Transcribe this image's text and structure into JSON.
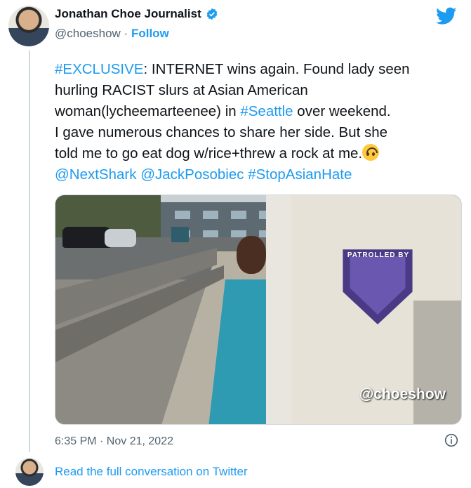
{
  "author": {
    "name": "Jonathan Choe Journalist",
    "handle": "@choeshow",
    "separator": "·",
    "follow_label": "Follow",
    "verified": true
  },
  "tweet": {
    "lines": [
      [
        {
          "t": "#EXCLUSIVE",
          "link": true
        },
        {
          "t": ": INTERNET wins again. Found lady seen",
          "link": false
        }
      ],
      [
        {
          "t": "hurling RACIST slurs at Asian American",
          "link": false
        }
      ],
      [
        {
          "t": "woman(lycheemarteenee) in ",
          "link": false
        },
        {
          "t": "#Seattle",
          "link": true
        },
        {
          "t": " over weekend.",
          "link": false
        }
      ],
      [
        {
          "t": "I gave numerous chances to share her side. But she",
          "link": false
        }
      ],
      [
        {
          "t": "told me to go eat dog w/rice+threw a rock at me.",
          "link": false
        }
      ],
      [
        {
          "t": "@NextShark",
          "link": true
        },
        {
          "t": " ",
          "link": false
        },
        {
          "t": "@JackPosobiec",
          "link": true
        },
        {
          "t": " ",
          "link": false
        },
        {
          "t": "#StopAsianHate",
          "link": true
        }
      ]
    ],
    "emoji_icon": "upside-down-face-emoji"
  },
  "media": {
    "watermark": "@choeshow",
    "badge_text": "PATROLLED BY"
  },
  "meta": {
    "timestamp": "6:35 PM · Nov 21, 2022",
    "read_more": "Read the full conversation on Twitter"
  },
  "colors": {
    "link": "#1d9bf0",
    "muted": "#536471",
    "text": "#0f1419"
  }
}
